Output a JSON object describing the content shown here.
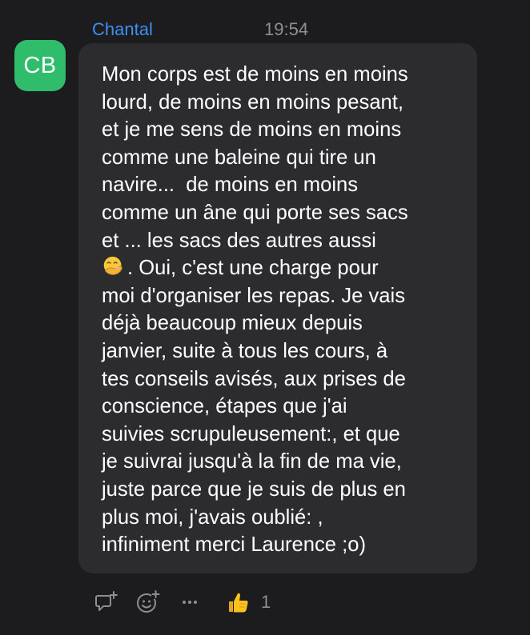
{
  "message": {
    "avatar_initials": "CB",
    "avatar_color": "#2fbd6c",
    "sender": "Chantal",
    "time": "19:54",
    "text_before_emoji": "Mon corps est de moins en moins\nlourd, de moins en moins pesant,\net je me sens de moins en moins\ncomme une baleine qui tire un\nnavire...  de moins en moins\ncomme un âne qui porte ses sacs\net ... les sacs des autres aussi\n",
    "emoji": "face-with-hand-over-mouth",
    "text_after_emoji": ". Oui, c'est une charge pour\nmoi d'organiser les repas. Je vais\ndéjà beaucoup mieux depuis\njanvier, suite à tous les cours, à\ntes conseils avisés, aux prises de\nconscience, étapes que j'ai\nsuivies scrupuleusement:, et que\nje suivrai jusqu'à la fin de ma vie,\njuste parce que je suis de plus en\nplus moi, j'avais oublié: ,\ninfiniment merci Laurence ;o)"
  },
  "actions": {
    "reply_icon": "reply-icon",
    "react_icon": "add-reaction-icon",
    "more_icon": "more-icon"
  },
  "reactions": [
    {
      "emoji": "thumbs-up",
      "count": "1"
    }
  ],
  "colors": {
    "background": "#1c1c1e",
    "bubble": "#2c2c2e",
    "sender": "#3f8ef2",
    "muted": "#8e8e93"
  }
}
